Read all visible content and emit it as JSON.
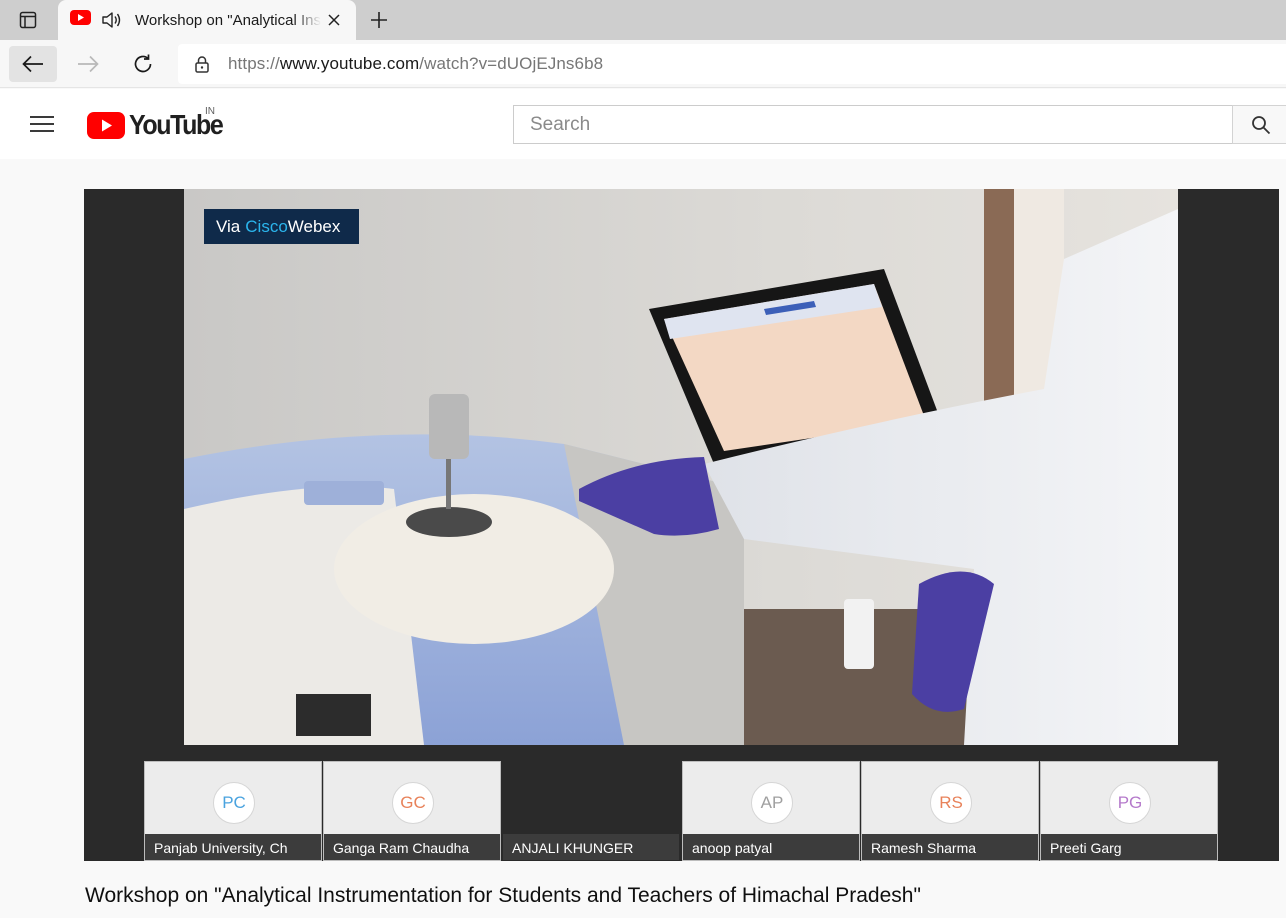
{
  "browser": {
    "tab": {
      "title": "Workshop on \"Analytical Instrumentation for Students and Teachers of Himachal Pradesh\" - YouTube",
      "favicon": "youtube-icon",
      "audio_icon": "speaker-icon"
    },
    "url": {
      "scheme": "https://",
      "host": "www.youtube.com",
      "path": "/watch?v=dUOjEJns6b8"
    }
  },
  "youtube": {
    "wordmark": "YouTube",
    "country_code": "IN",
    "search_placeholder": "Search",
    "brand_color": "#ff0000"
  },
  "player": {
    "badge": {
      "via": "Via",
      "cisco": "Cisco",
      "webex": "Webex"
    },
    "participants": [
      {
        "initials": "PC",
        "name": "Panjab University, Ch",
        "color": "#4aa3df"
      },
      {
        "initials": "GC",
        "name": "Ganga Ram Chaudha",
        "color": "#e8825a"
      },
      {
        "initials": "",
        "name": "ANJALI KHUNGER",
        "color": ""
      },
      {
        "initials": "AP",
        "name": "anoop patyal",
        "color": "#a0a0a0"
      },
      {
        "initials": "RS",
        "name": "Ramesh Sharma",
        "color": "#e8825a"
      },
      {
        "initials": "PG",
        "name": "Preeti Garg",
        "color": "#b57acb"
      }
    ]
  },
  "video": {
    "title": "Workshop on \"Analytical Instrumentation for Students and Teachers of Himachal Pradesh\""
  }
}
